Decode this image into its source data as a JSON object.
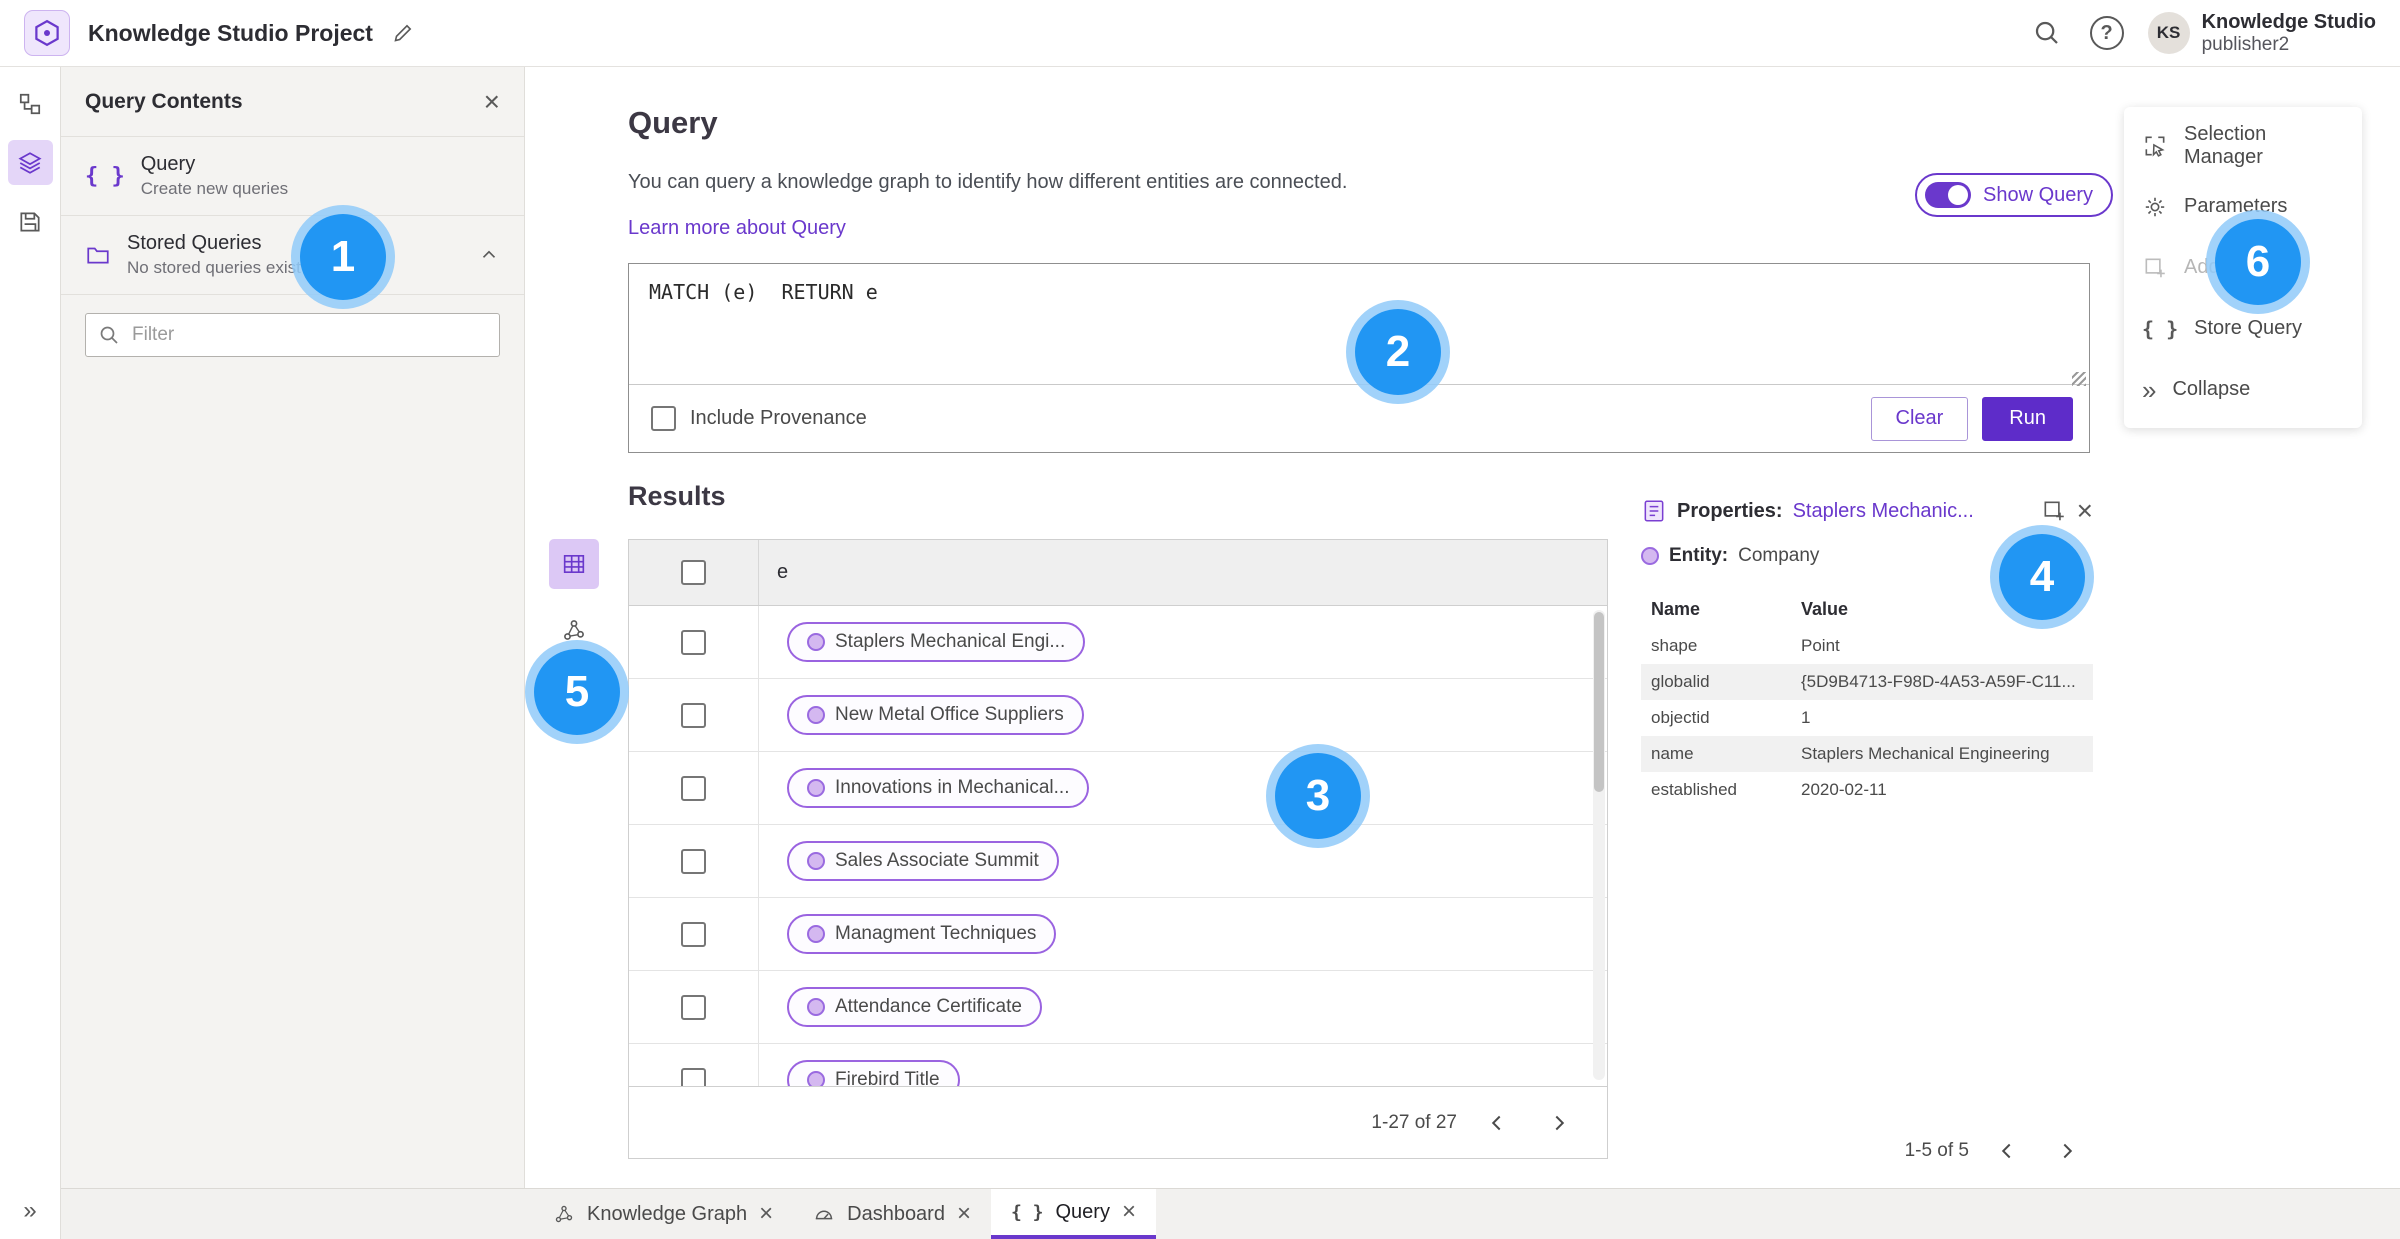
{
  "colors": {
    "accent": "#6a38cc",
    "run_button": "#5e2cc9",
    "badge_blue": "#2196f3"
  },
  "icons": {
    "close": "×",
    "help": "?",
    "collapse": "»",
    "braces": "{ }"
  },
  "topbar": {
    "title": "Knowledge Studio Project",
    "user_name": "Knowledge Studio",
    "user_sub": "publisher2",
    "avatar_initials": "KS"
  },
  "left_panel": {
    "title": "Query Contents",
    "items": [
      {
        "label": "Query",
        "sublabel": "Create new queries"
      },
      {
        "label": "Stored Queries",
        "sublabel": "No stored queries exist"
      }
    ],
    "filter_placeholder": "Filter"
  },
  "query": {
    "title": "Query",
    "description": "You can query a knowledge graph to identify how different entities are connected.",
    "learn_more": "Learn more about Query",
    "show_query_label": "Show Query",
    "query_text": "MATCH (e)  RETURN e",
    "include_provenance_label": "Include Provenance",
    "clear_label": "Clear",
    "run_label": "Run"
  },
  "results": {
    "title": "Results",
    "column_header": "e",
    "rows": [
      "Staplers Mechanical Engi...",
      "New Metal Office Suppliers",
      "Innovations in Mechanical...",
      "Sales Associate Summit",
      "Managment Techniques",
      "Attendance Certificate",
      "Firebird Title"
    ],
    "pagination": "1-27 of 27"
  },
  "properties": {
    "title": "Properties:",
    "link": "Staplers Mechanic...",
    "entity_label": "Entity:",
    "entity_value": "Company",
    "columns": [
      "Name",
      "Value"
    ],
    "rows": [
      {
        "name": "shape",
        "value": "Point"
      },
      {
        "name": "globalid",
        "value": "{5D9B4713-F98D-4A53-A59F-C11..."
      },
      {
        "name": "objectid",
        "value": "1"
      },
      {
        "name": "name",
        "value": "Staplers Mechanical Engineering"
      },
      {
        "name": "established",
        "value": "2020-02-11"
      }
    ],
    "pagination": "1-5 of 5"
  },
  "actions_menu": {
    "items": [
      {
        "label": "Selection Manager"
      },
      {
        "label": "Parameters"
      },
      {
        "label": "Add To Map"
      },
      {
        "label": "Store Query"
      },
      {
        "label": "Collapse"
      }
    ]
  },
  "bottom_tabs": [
    {
      "label": "Knowledge Graph"
    },
    {
      "label": "Dashboard"
    },
    {
      "label": "Query"
    }
  ],
  "annotations": [
    "1",
    "2",
    "3",
    "4",
    "5",
    "6"
  ]
}
